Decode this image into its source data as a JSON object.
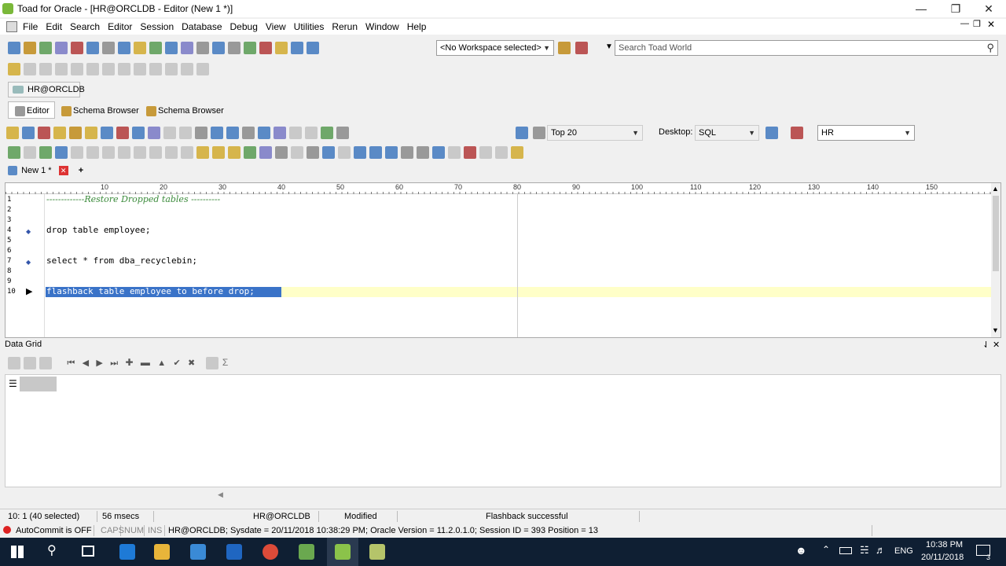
{
  "app": {
    "title": "Toad for Oracle - [HR@ORCLDB - Editor (New 1 *)]"
  },
  "menu": [
    "File",
    "Edit",
    "Search",
    "Editor",
    "Session",
    "Database",
    "Debug",
    "View",
    "Utilities",
    "Rerun",
    "Window",
    "Help"
  ],
  "toolbar": {
    "workspace_value": "<No Workspace selected>",
    "search_placeholder": "Search Toad World",
    "top_value": "Top 20",
    "desktop_label": "Desktop:",
    "desktop_value": "SQL",
    "schema_value": "HR"
  },
  "connection_tab": "HR@ORCLDB",
  "window_tabs": [
    "Editor",
    "Schema Browser",
    "Schema Browser"
  ],
  "editor_tab": "New 1 *",
  "ruler_ticks": [
    "10",
    "20",
    "30",
    "40",
    "50",
    "60",
    "70",
    "80",
    "90",
    "100",
    "110",
    "120",
    "130",
    "140",
    "150"
  ],
  "code_lines": [
    {
      "n": "1",
      "text": "-------------Restore Dropped tables ----------"
    },
    {
      "n": "2",
      "text": ""
    },
    {
      "n": "3",
      "text": ""
    },
    {
      "n": "4",
      "text": "drop table employee;"
    },
    {
      "n": "5",
      "text": ""
    },
    {
      "n": "6",
      "text": ""
    },
    {
      "n": "7",
      "text": "select * from dba_recyclebin;"
    },
    {
      "n": "8",
      "text": ""
    },
    {
      "n": "9",
      "text": ""
    },
    {
      "n": "10",
      "text": "flashback table employee to before drop;"
    }
  ],
  "data_grid_title": "Data Grid",
  "status": {
    "position": "10:  1 (40 selected)",
    "time": "56 msecs",
    "connection": "HR@ORCLDB",
    "state": "Modified",
    "message": "Flashback successful",
    "autocommit": "AutoCommit is OFF",
    "caps": "CAPS",
    "num": "NUM",
    "ins": "INS",
    "details": "HR@ORCLDB;  Sysdate = 20/11/2018 10:38:29 PM;  Oracle Version = 11.2.0.1.0;  Session ID = 393 Position = 13"
  },
  "taskbar": {
    "time": "10:38 PM",
    "date": "20/11/2018",
    "lang": "ENG",
    "notif_count": "3"
  }
}
